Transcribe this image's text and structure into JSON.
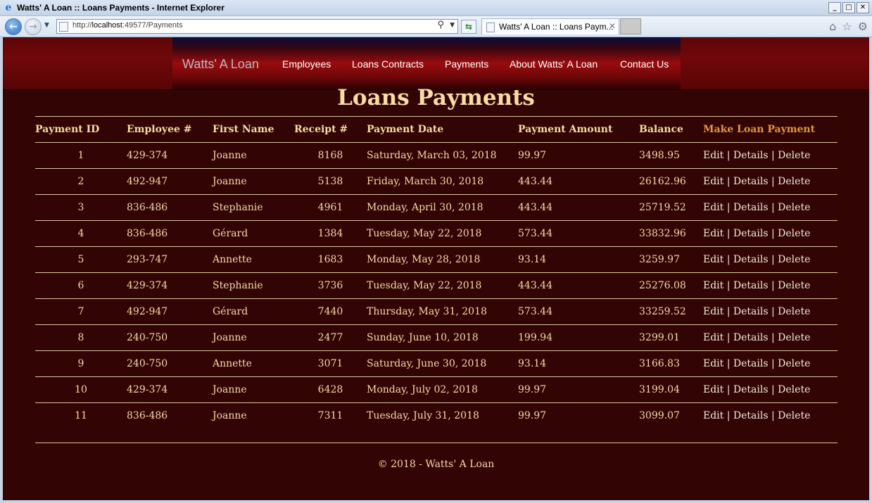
{
  "window": {
    "title": "Watts' A Loan :: Loans Payments - Internet Explorer",
    "controls": [
      "_",
      "□",
      "✕"
    ]
  },
  "browser": {
    "url_prefix": "http://",
    "url_host": "localhost",
    "url_rest": ":49577/Payments",
    "tab_label": "Watts' A Loan :: Loans Paym...",
    "tab_close": "✕"
  },
  "nav": {
    "brand": "Watts' A Loan",
    "links": [
      "Employees",
      "Loans Contracts",
      "Payments",
      "About Watts' A Loan",
      "Contact Us"
    ]
  },
  "page": {
    "title": "Loans Payments",
    "columns": [
      "Payment ID",
      "Employee #",
      "First Name",
      "Receipt #",
      "Payment Date",
      "Payment Amount",
      "Balance"
    ],
    "make_payment_label": "Make Loan Payment",
    "actions": {
      "edit": "Edit",
      "details": "Details",
      "delete": "Delete",
      "separator": "|"
    },
    "rows": [
      {
        "id": "1",
        "employee": "429-374",
        "first_name": "Joanne",
        "receipt": "8168",
        "date": "Saturday, March 03, 2018",
        "amount": "99.97",
        "balance": "3498.95"
      },
      {
        "id": "2",
        "employee": "492-947",
        "first_name": "Joanne",
        "receipt": "5138",
        "date": "Friday, March 30, 2018",
        "amount": "443.44",
        "balance": "26162.96"
      },
      {
        "id": "3",
        "employee": "836-486",
        "first_name": "Stephanie",
        "receipt": "4961",
        "date": "Monday, April 30, 2018",
        "amount": "443.44",
        "balance": "25719.52"
      },
      {
        "id": "4",
        "employee": "836-486",
        "first_name": "Gérard",
        "receipt": "1384",
        "date": "Tuesday, May 22, 2018",
        "amount": "573.44",
        "balance": "33832.96"
      },
      {
        "id": "5",
        "employee": "293-747",
        "first_name": "Annette",
        "receipt": "1683",
        "date": "Monday, May 28, 2018",
        "amount": "93.14",
        "balance": "3259.97"
      },
      {
        "id": "6",
        "employee": "429-374",
        "first_name": "Stephanie",
        "receipt": "3736",
        "date": "Tuesday, May 22, 2018",
        "amount": "443.44",
        "balance": "25276.08"
      },
      {
        "id": "7",
        "employee": "492-947",
        "first_name": "Gérard",
        "receipt": "7440",
        "date": "Thursday, May 31, 2018",
        "amount": "573.44",
        "balance": "33259.52"
      },
      {
        "id": "8",
        "employee": "240-750",
        "first_name": "Joanne",
        "receipt": "2477",
        "date": "Sunday, June 10, 2018",
        "amount": "199.94",
        "balance": "3299.01"
      },
      {
        "id": "9",
        "employee": "240-750",
        "first_name": "Annette",
        "receipt": "3071",
        "date": "Saturday, June 30, 2018",
        "amount": "93.14",
        "balance": "3166.83"
      },
      {
        "id": "10",
        "employee": "429-374",
        "first_name": "Joanne",
        "receipt": "6428",
        "date": "Monday, July 02, 2018",
        "amount": "99.97",
        "balance": "3199.04"
      },
      {
        "id": "11",
        "employee": "836-486",
        "first_name": "Joanne",
        "receipt": "7311",
        "date": "Tuesday, July 31, 2018",
        "amount": "99.97",
        "balance": "3099.07"
      }
    ],
    "footer": "© 2018 - Watts' A Loan"
  },
  "colors": {
    "page_background": "#320404",
    "text": "#f7dca4",
    "make_payment_link": "#e09a3a"
  },
  "icons": [
    "ie-logo-icon",
    "back-arrow-icon",
    "forward-arrow-icon",
    "page-icon",
    "search-icon",
    "refresh-icon",
    "home-icon",
    "favorites-star-icon",
    "settings-gear-icon"
  ]
}
